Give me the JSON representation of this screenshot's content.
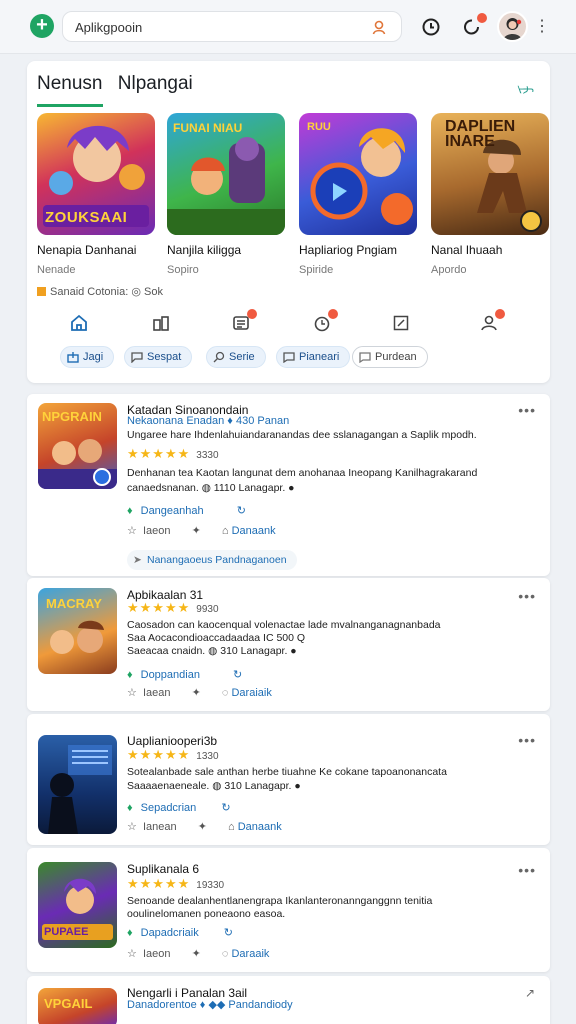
{
  "header": {
    "search_value": "Aplikgpooin",
    "icons": [
      "plus-icon",
      "user-icon",
      "clock-icon",
      "notification-icon",
      "avatar",
      "more-vertical-icon"
    ]
  },
  "featured": {
    "tab_active": "Nenusn",
    "tab_other": "Nlpangai",
    "more_label": "ᢣᢣ",
    "tiles": [
      {
        "title": "Nenapia Danhanai",
        "sub": "Nenade",
        "art_text": "ZOUKSAAI"
      },
      {
        "title": "Nanjila kiligga",
        "sub": "Sopiro",
        "art_text": "FUNAI NIAU"
      },
      {
        "title": "Hapliariog Pngiam",
        "sub": "Spiride",
        "art_text": "RUU"
      },
      {
        "title": "Nanal Ihuaah",
        "sub": "Apordo",
        "art_text": "DAPLIEN INARE"
      }
    ],
    "tag_row": "Sanaid Cotonia: ◎ Sok",
    "chips": [
      "Jagi",
      "Sespat",
      "Serie",
      "Pianeari",
      "Purdean"
    ]
  },
  "list": [
    {
      "title": "Katadan Sinoanondain",
      "sub_line": "Nekaonana Enadan ♦ 430 Panan",
      "stars": "★★★★★",
      "rating_count": "3330",
      "desc_lines": [
        "Ungaree hare Ihdenlahuiandaranandas dee sslanagangan a Saplik mpodh.",
        "Denhanan tea Kaotan langunat dem anohanaa Ineopang Kanilhagrakarand",
        "canaedsnanan. ◍ 1110 Lanagapr. ●"
      ],
      "action_primary": "Dangeanhah",
      "action_secondary": "Iaeon",
      "action_third": "Danaank",
      "footer_chip": "Nanangaoeus  Pandnaganoen"
    },
    {
      "title": "Apbikaalan 31",
      "stars": "★★★★★",
      "rating_count": "9930",
      "desc_lines": [
        "Caosadon can kaocenqual volenactae lade mvalnanganagnanbada",
        "Saa Aocacondioaccadaadaa IC 500 Q",
        "Saeacaa cnaidn. ◍ 310 Lanagapr. ●"
      ],
      "action_primary": "Doppandian",
      "action_secondary": "Iaean",
      "action_third": "Daraiaik"
    },
    {
      "title": "Uaplianiooperi3b",
      "stars": "★★★★★",
      "rating_count": "1330",
      "desc_lines": [
        "Sotealanbade sale anthan herbe tiuahne Ke cokane tapoanonancata",
        "Saaaaenaeneale. ◍ 310 Lanagapr. ●"
      ],
      "action_primary": "Sepadcrian",
      "action_secondary": "Ianean",
      "action_third": "Danaank"
    },
    {
      "title": "Suplikanala 6",
      "stars": "★★★★★",
      "rating_count": "19330",
      "desc_lines": [
        "Senoande dealanhentlanengrapa Ikanlanteronannganggnn tenitia",
        "ooulinelomanen poneaono easoa."
      ],
      "action_primary": "Dapadcriaik",
      "action_secondary": "Iaeon",
      "action_third": "Daraaik"
    },
    {
      "title": "Nengarli i Panalan 3ail",
      "sub_line": "Danadorentoe ♦ ◆◆ Pandandiody"
    }
  ]
}
